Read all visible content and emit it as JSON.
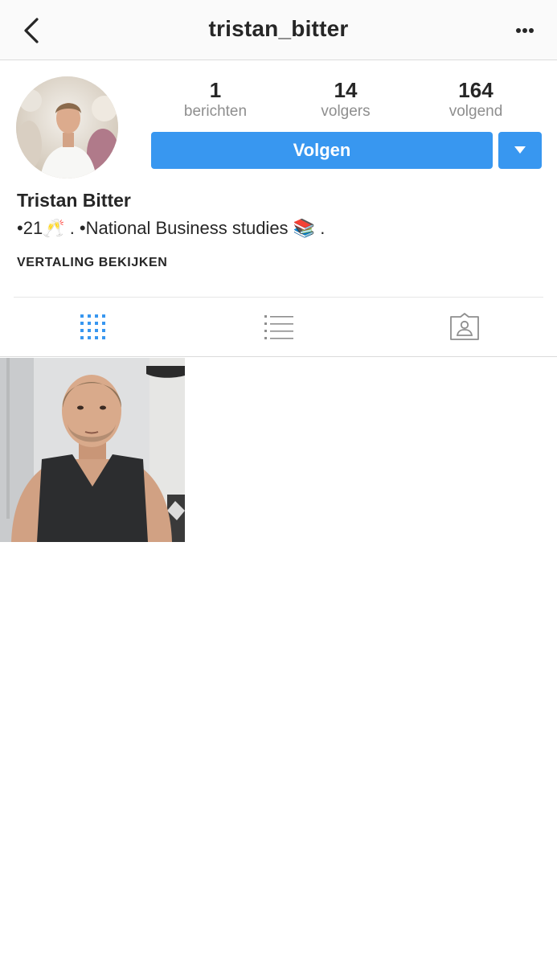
{
  "header": {
    "title": "tristan_bitter",
    "back_icon": "chevron-left-icon",
    "more_icon": "more-horizontal-icon"
  },
  "profile": {
    "stats": [
      {
        "value": "1",
        "label": "berichten"
      },
      {
        "value": "14",
        "label": "volgers"
      },
      {
        "value": "164",
        "label": "volgend"
      }
    ],
    "follow_label": "Volgen",
    "name": "Tristan Bitter",
    "bio": {
      "part1": "•21",
      "glyph1": "🥂",
      "part2": " . •National Business studies ",
      "glyph2": "📚",
      "part3": " ."
    },
    "translate_label": "VERTALING BEKIJKEN"
  },
  "tabs": [
    {
      "name": "grid",
      "icon": "grid-icon",
      "active": true
    },
    {
      "name": "list",
      "icon": "list-icon",
      "active": false
    },
    {
      "name": "tagged",
      "icon": "tagged-person-icon",
      "active": false
    }
  ],
  "colors": {
    "accent": "#3897f0",
    "text": "#262626",
    "muted": "#8e8e8e",
    "divider": "#dbdbdb",
    "header_bg": "#fafafa"
  }
}
